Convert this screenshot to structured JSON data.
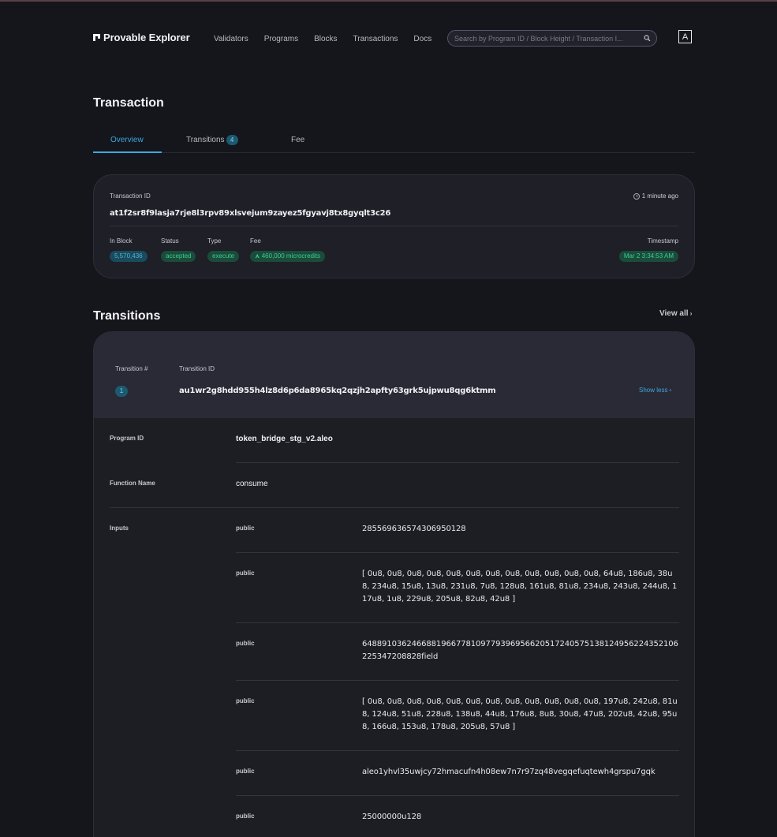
{
  "header": {
    "logo_text": "Provable Explorer",
    "nav": [
      "Validators",
      "Programs",
      "Blocks",
      "Transactions",
      "Docs"
    ],
    "search_placeholder": "Search by Program ID / Block Height / Transaction I...",
    "theme_toggle": "A"
  },
  "page_title": "Transaction",
  "tabs": {
    "overview": "Overview",
    "transitions": "Transitions",
    "transitions_count": "4",
    "fee": "Fee"
  },
  "summary": {
    "tx_id_label": "Transaction ID",
    "tx_id": "at1f2sr8f9lasja7rje8l3rpv89xlsvejum9zayez5fgyavj8tx8gyqlt3c26",
    "time_ago": "1 minute ago",
    "in_block_label": "In Block",
    "in_block": "5,570,436",
    "status_label": "Status",
    "status": "accepted",
    "type_label": "Type",
    "type": "execute",
    "fee_label": "Fee",
    "fee": "460,000 microcredits",
    "timestamp_label": "Timestamp",
    "timestamp": "Mar 2 3:34:53 AM"
  },
  "transitions": {
    "title": "Transitions",
    "view_all": "View all",
    "col_num": "Transition #",
    "col_id": "Transition ID",
    "num": "1",
    "id": "au1wr2g8hdd955h4lz8d6p6da8965kq2qzjh2apfty63grk5ujpwu8qg6ktmm",
    "show_less": "Show less",
    "program_id_label": "Program ID",
    "program_id": "token_bridge_stg_v2.aleo",
    "function_label": "Function Name",
    "function": "consume",
    "inputs_label": "Inputs",
    "inputs": [
      {
        "vis": "public",
        "value": "285569636574306950128"
      },
      {
        "vis": "public",
        "value": "[ 0u8, 0u8, 0u8, 0u8, 0u8, 0u8, 0u8, 0u8, 0u8, 0u8, 0u8, 0u8, 64u8, 186u8, 38u8, 234u8, 15u8, 13u8, 231u8, 7u8, 128u8, 161u8, 81u8, 234u8, 243u8, 244u8, 117u8, 1u8, 229u8, 205u8, 82u8, 42u8 ]"
      },
      {
        "vis": "public",
        "value": "6488910362466881966778109779396956620517240575138124956224352106225347208828field"
      },
      {
        "vis": "public",
        "value": "[ 0u8, 0u8, 0u8, 0u8, 0u8, 0u8, 0u8, 0u8, 0u8, 0u8, 0u8, 0u8, 197u8, 242u8, 81u8, 124u8, 51u8, 228u8, 138u8, 44u8, 176u8, 8u8, 30u8, 47u8, 202u8, 42u8, 95u8, 166u8, 153u8, 178u8, 205u8, 57u8 ]"
      },
      {
        "vis": "public",
        "value": "aleo1yhvl35uwjcy72hmacufn4h08ew7n7r97zq48vegqefuqtewh4grspu7gqk"
      },
      {
        "vis": "public",
        "value": "25000000u128"
      }
    ]
  }
}
